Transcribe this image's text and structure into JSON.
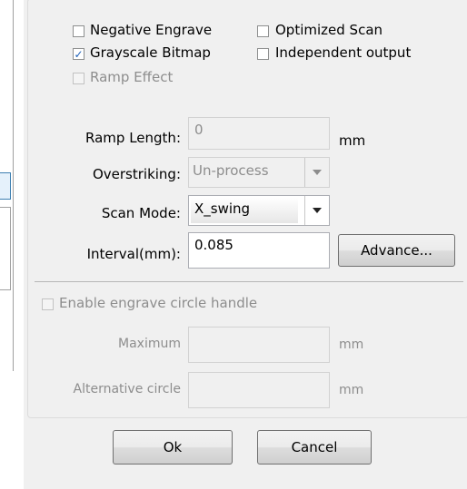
{
  "options": {
    "negative_engrave": {
      "label": "Negative Engrave",
      "checked": false
    },
    "optimized_scan": {
      "label": "Optimized Scan",
      "checked": false
    },
    "grayscale_bitmap": {
      "label": "Grayscale Bitmap",
      "checked": true
    },
    "independent_output": {
      "label": "Independent output",
      "checked": false
    },
    "ramp_effect": {
      "label": "Ramp Effect",
      "checked": false,
      "disabled": true
    }
  },
  "fields": {
    "ramp_length": {
      "label": "Ramp Length:",
      "value": "0",
      "unit": "mm"
    },
    "overstriking": {
      "label": "Overstriking:",
      "value": "Un-process"
    },
    "scan_mode": {
      "label": "Scan Mode:",
      "value": "X_swing"
    },
    "interval": {
      "label": "Interval(mm):",
      "value": "0.085"
    }
  },
  "advance_button": "Advance...",
  "circle": {
    "enable_label": "Enable engrave circle handle",
    "maximum_label": "Maximum",
    "maximum_unit": "mm",
    "alternative_label": "Alternative circle",
    "alternative_unit": "mm"
  },
  "dialog_buttons": {
    "ok": "Ok",
    "cancel": "Cancel"
  },
  "colors": {
    "check_accent": "#1c5fb8",
    "panel_bg": "#f0f0f0"
  }
}
